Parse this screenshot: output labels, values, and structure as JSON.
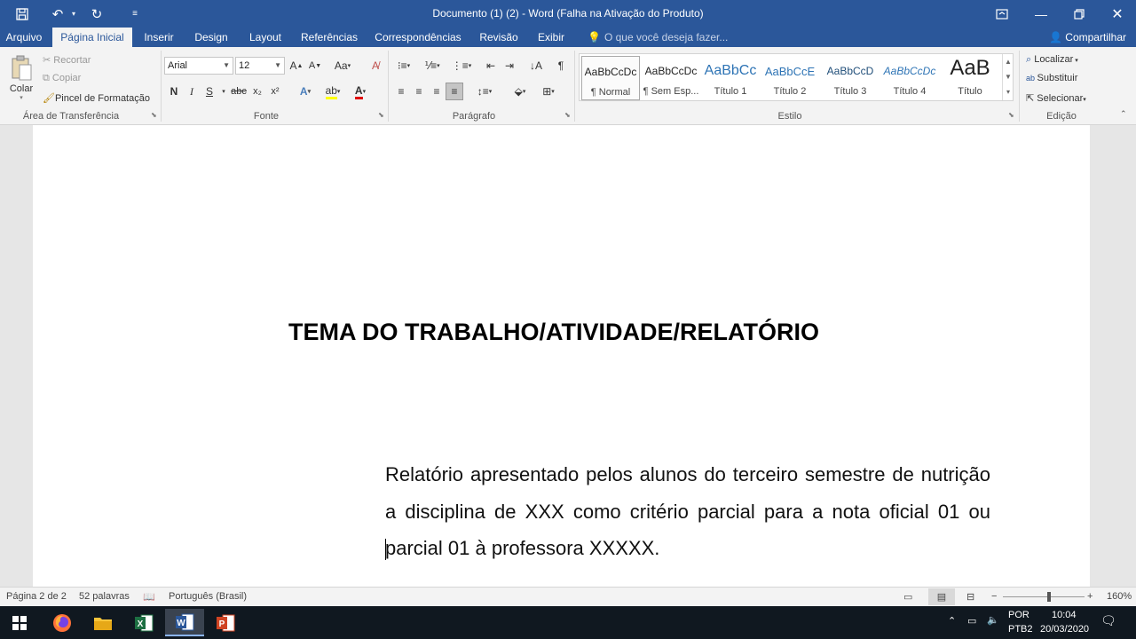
{
  "window": {
    "title": "Documento (1) (2) - Word (Falha na Ativação do Produto)"
  },
  "tabs": [
    "Arquivo",
    "Página Inicial",
    "Inserir",
    "Design",
    "Layout",
    "Referências",
    "Correspondências",
    "Revisão",
    "Exibir"
  ],
  "tell_me": "O que você deseja fazer...",
  "share": "Compartilhar",
  "clipboard": {
    "paste": "Colar",
    "cut": "Recortar",
    "copy": "Copiar",
    "format_painter": "Pincel de Formatação",
    "label": "Área de Transferência"
  },
  "font": {
    "name": "Arial",
    "size": "12",
    "label": "Fonte",
    "case": "Aa",
    "bold": "N",
    "italic": "I",
    "underline": "S",
    "strike": "abc",
    "subscript": "x₂",
    "superscript": "x²"
  },
  "paragraph": {
    "label": "Parágrafo",
    "pilcrow": "¶"
  },
  "styles": {
    "label": "Estilo",
    "items": [
      {
        "sample": "AaBbCcDc",
        "name": "¶ Normal"
      },
      {
        "sample": "AaBbCcDc",
        "name": "¶ Sem Esp..."
      },
      {
        "sample": "AaBbCc",
        "name": "Título 1"
      },
      {
        "sample": "AaBbCcE",
        "name": "Título 2"
      },
      {
        "sample": "AaBbCcD",
        "name": "Título 3"
      },
      {
        "sample": "AaBbCcDc",
        "name": "Título 4"
      },
      {
        "sample": "AaB",
        "name": "Título"
      }
    ]
  },
  "editing": {
    "label": "Edição",
    "find": "Localizar",
    "replace": "Substituir",
    "select": "Selecionar"
  },
  "document": {
    "title": "TEMA DO TRABALHO/ATIVIDADE/RELATÓRIO",
    "paragraph": "Relatório apresentado pelos alunos do terceiro semestre de nutrição a disciplina de XXX como critério parcial para a nota oficial 01 ou parcial 01 à professora XXXXX."
  },
  "status": {
    "page": "Página 2 de 2",
    "words": "52 palavras",
    "language": "Português (Brasil)",
    "zoom": "160%"
  },
  "taskbar": {
    "lang_top": "POR",
    "lang_bottom": "PTB2",
    "time": "10:04",
    "date": "20/03/2020"
  }
}
